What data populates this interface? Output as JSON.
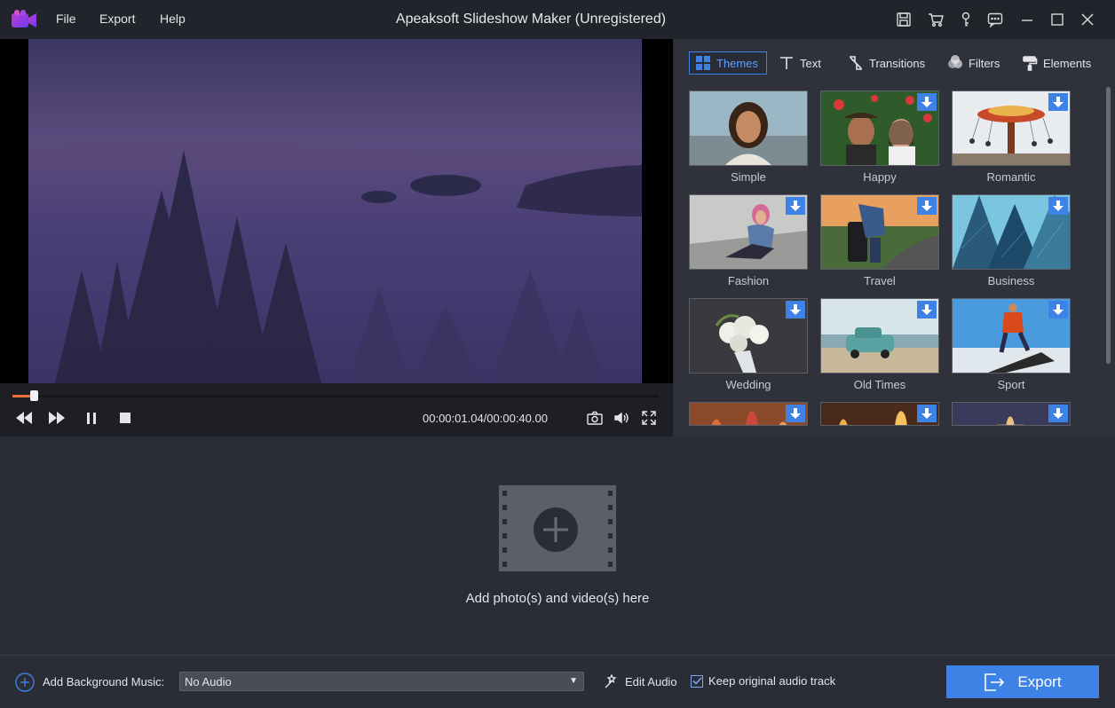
{
  "window": {
    "title": "Apeaksoft Slideshow Maker (Unregistered)",
    "menu": [
      "File",
      "Export",
      "Help"
    ],
    "icons": [
      "save-icon",
      "cart-icon",
      "key-icon",
      "feedback-icon",
      "minimize-icon",
      "maximize-icon",
      "close-icon"
    ]
  },
  "player": {
    "timecode": "00:00:01.04/00:00:40.00",
    "progress": 0.033,
    "controls": [
      "rewind-icon",
      "fast-forward-icon",
      "pause-icon",
      "stop-icon"
    ],
    "right_controls": [
      "snapshot-icon",
      "volume-icon",
      "fullscreen-icon"
    ]
  },
  "panel": {
    "tabs": [
      {
        "label": "Themes",
        "icon": "grid-icon",
        "active": true
      },
      {
        "label": "Text",
        "icon": "text-icon",
        "active": false
      },
      {
        "label": "Transitions",
        "icon": "transition-icon",
        "active": false
      },
      {
        "label": "Filters",
        "icon": "filter-icon",
        "active": false
      },
      {
        "label": "Elements",
        "icon": "paint-roller-icon",
        "active": false
      }
    ],
    "themes": [
      {
        "name": "Simple",
        "downloadable": false
      },
      {
        "name": "Happy",
        "downloadable": true
      },
      {
        "name": "Romantic",
        "downloadable": true
      },
      {
        "name": "Fashion",
        "downloadable": true
      },
      {
        "name": "Travel",
        "downloadable": true
      },
      {
        "name": "Business",
        "downloadable": true
      },
      {
        "name": "Wedding",
        "downloadable": true
      },
      {
        "name": "Old Times",
        "downloadable": true
      },
      {
        "name": "Sport",
        "downloadable": true
      },
      {
        "name": "",
        "downloadable": true
      },
      {
        "name": "",
        "downloadable": true
      },
      {
        "name": "",
        "downloadable": true
      }
    ]
  },
  "drop": {
    "text": "Add photo(s) and video(s) here"
  },
  "bottom": {
    "bg_music_label": "Add Background Music:",
    "audio_value": "No Audio",
    "edit_audio": "Edit Audio",
    "keep_original": "Keep original audio track",
    "keep_checked": true,
    "export": "Export"
  },
  "colors": {
    "accent": "#3e82e6",
    "progress": "#e8703a"
  }
}
